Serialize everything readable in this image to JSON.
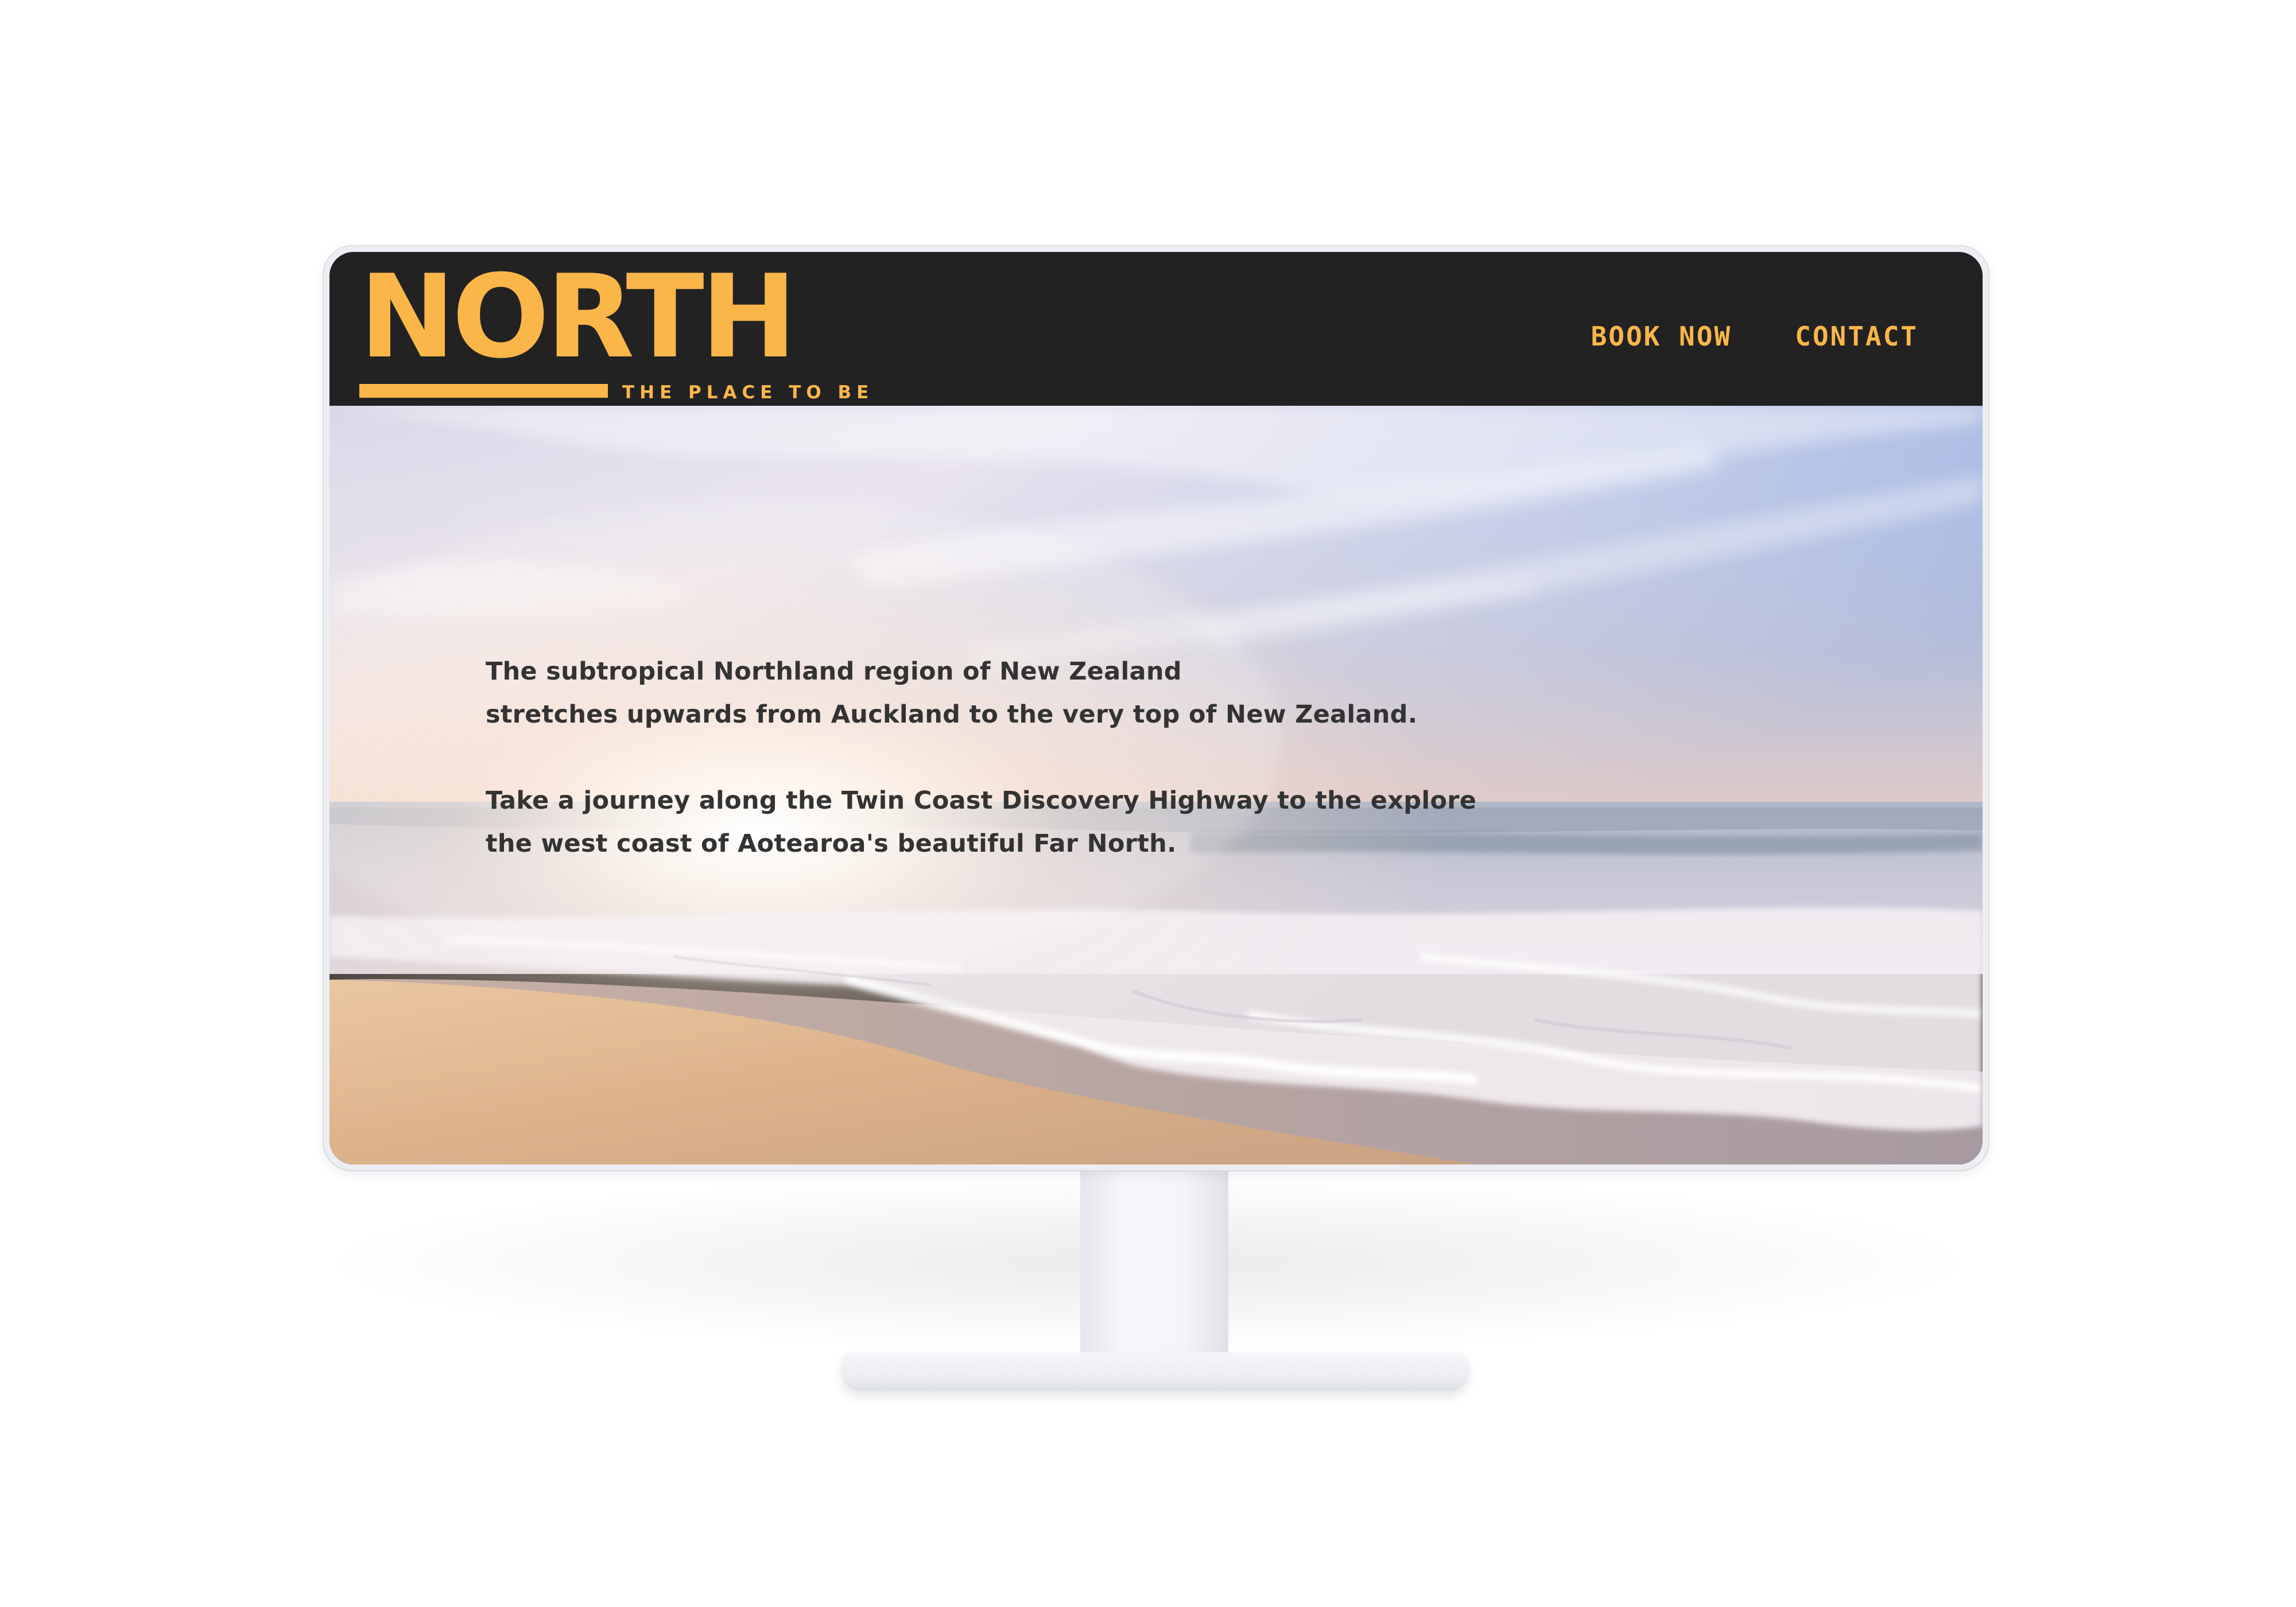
{
  "logo": {
    "wordmark": "NORTH",
    "tagline": "THE PLACE TO BE"
  },
  "nav": {
    "items": [
      {
        "label": "BOOK NOW"
      },
      {
        "label": "CONTACT"
      }
    ]
  },
  "hero": {
    "paragraphs": [
      "The subtropical Northland region of New Zealand\nstretches upwards from Auckland to the very top of New Zealand.",
      "Take a journey along the Twin Coast Discovery Highway to the explore\nthe west coast of Aotearoa's beautiful Far North."
    ]
  },
  "colors": {
    "brand": "#fbb64a",
    "header_bg": "#222222",
    "hero_text": "#333333"
  }
}
